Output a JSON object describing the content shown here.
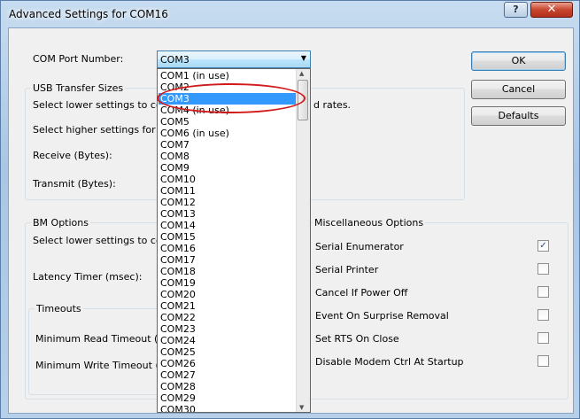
{
  "window": {
    "title": "Advanced Settings for COM16",
    "help_glyph": "?",
    "close_glyph": "✕"
  },
  "com_port": {
    "label": "COM Port Number:",
    "selected": "COM3",
    "arrow": "▼"
  },
  "buttons": {
    "ok": "OK",
    "cancel": "Cancel",
    "defaults": "Defaults"
  },
  "usb": {
    "title": "USB Transfer Sizes",
    "line1_start": "Select lower settings to corre",
    "line1_end": "d rates.",
    "line2_start": "Select higher settings for fas",
    "receive": "Receive (Bytes):",
    "transmit": "Transmit (Bytes):"
  },
  "bm": {
    "title": "BM Options",
    "line1_start": "Select lower settings to corre",
    "latency": "Latency Timer (msec):"
  },
  "timeouts": {
    "title": "Timeouts",
    "read": "Minimum Read Timeout (msec",
    "write": "Minimum Write Timeout (msec"
  },
  "misc": {
    "title": "Miscellaneous Options",
    "options": [
      {
        "label": "Serial Enumerator",
        "checked": true
      },
      {
        "label": "Serial Printer",
        "checked": false
      },
      {
        "label": "Cancel If Power Off",
        "checked": false
      },
      {
        "label": "Event On Surprise Removal",
        "checked": false
      },
      {
        "label": "Set RTS On Close",
        "checked": false
      },
      {
        "label": "Disable Modem Ctrl At Startup",
        "checked": false
      }
    ]
  },
  "dropdown": {
    "selected_index": 1,
    "items": [
      "COM1 (in use)",
      "COM2",
      "COM3",
      "COM4 (in use)",
      "COM5",
      "COM6 (in use)",
      "COM7",
      "COM8",
      "COM9",
      "COM10",
      "COM11",
      "COM12",
      "COM13",
      "COM14",
      "COM15",
      "COM16",
      "COM17",
      "COM18",
      "COM19",
      "COM20",
      "COM21",
      "COM22",
      "COM23",
      "COM24",
      "COM25",
      "COM26",
      "COM27",
      "COM28",
      "COM29",
      "COM30"
    ]
  },
  "colors": {
    "selection": "#3399ff",
    "annotation": "#d21a1a",
    "check": "#2b4a8a"
  }
}
